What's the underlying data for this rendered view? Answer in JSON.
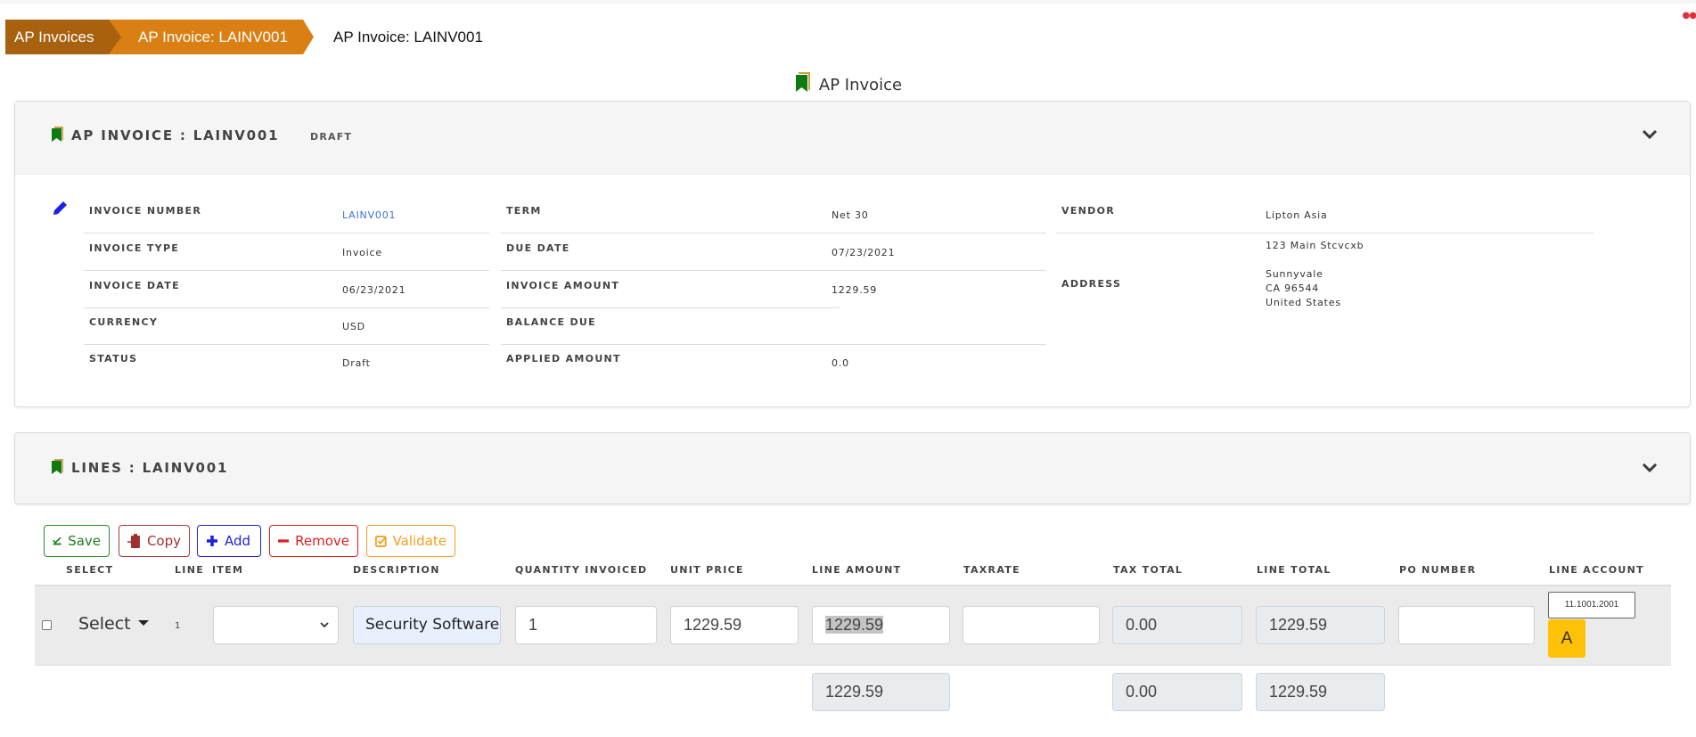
{
  "breadcrumb": {
    "items": [
      "AP Invoices",
      "AP Invoice: LAINV001"
    ],
    "current": "AP Invoice: LAINV001"
  },
  "page_title": "AP Invoice",
  "header_card": {
    "title": "AP INVOICE : LAINV001",
    "status_badge": "DRAFT",
    "fields": {
      "invoice_number": {
        "label": "INVOICE NUMBER",
        "value": "LAINV001"
      },
      "invoice_type": {
        "label": "INVOICE TYPE",
        "value": "Invoice"
      },
      "invoice_date": {
        "label": "INVOICE DATE",
        "value": "06/23/2021"
      },
      "currency": {
        "label": "CURRENCY",
        "value": "USD"
      },
      "status": {
        "label": "STATUS",
        "value": "Draft"
      },
      "term": {
        "label": "TERM",
        "value": "Net 30"
      },
      "due_date": {
        "label": "DUE DATE",
        "value": "07/23/2021"
      },
      "invoice_amount": {
        "label": "INVOICE AMOUNT",
        "value": "1229.59"
      },
      "balance_due": {
        "label": "BALANCE DUE",
        "value": ""
      },
      "applied_amount": {
        "label": "APPLIED AMOUNT",
        "value": "0.0"
      },
      "vendor": {
        "label": "VENDOR",
        "value": "Lipton Asia"
      },
      "address": {
        "label": "ADDRESS",
        "lines": [
          "123 Main Stcvcxb",
          "Sunnyvale",
          "CA 96544",
          "United States"
        ]
      }
    }
  },
  "lines_card": {
    "title": "LINES : LAINV001"
  },
  "toolbar": {
    "save": "Save",
    "copy": "Copy",
    "add": "Add",
    "remove": "Remove",
    "validate": "Validate"
  },
  "table": {
    "columns": [
      "SELECT",
      "LINE",
      "ITEM",
      "DESCRIPTION",
      "QUANTITY INVOICED",
      "UNIT PRICE",
      "LINE AMOUNT",
      "TAXRATE",
      "TAX TOTAL",
      "LINE TOTAL",
      "PO NUMBER",
      "LINE ACCOUNT"
    ],
    "rows": [
      {
        "select_label": "Select",
        "line": "1",
        "item": "",
        "description": "Security Software",
        "quantity_invoiced": "1",
        "unit_price": "1229.59",
        "line_amount": "1229.59",
        "taxrate": "",
        "tax_total": "0.00",
        "line_total": "1229.59",
        "po_number": "",
        "line_account": "11.1001.2001",
        "account_button": "A"
      }
    ],
    "totals": {
      "line_amount": "1229.59",
      "tax_total": "0.00",
      "line_total": "1229.59"
    }
  },
  "colors": {
    "breadcrumb_dark": "#a8610f",
    "breadcrumb_light": "#d97f14",
    "icon_green": "#0f7a0f",
    "link_blue": "#3b73d9",
    "account_button": "#ffc107"
  }
}
